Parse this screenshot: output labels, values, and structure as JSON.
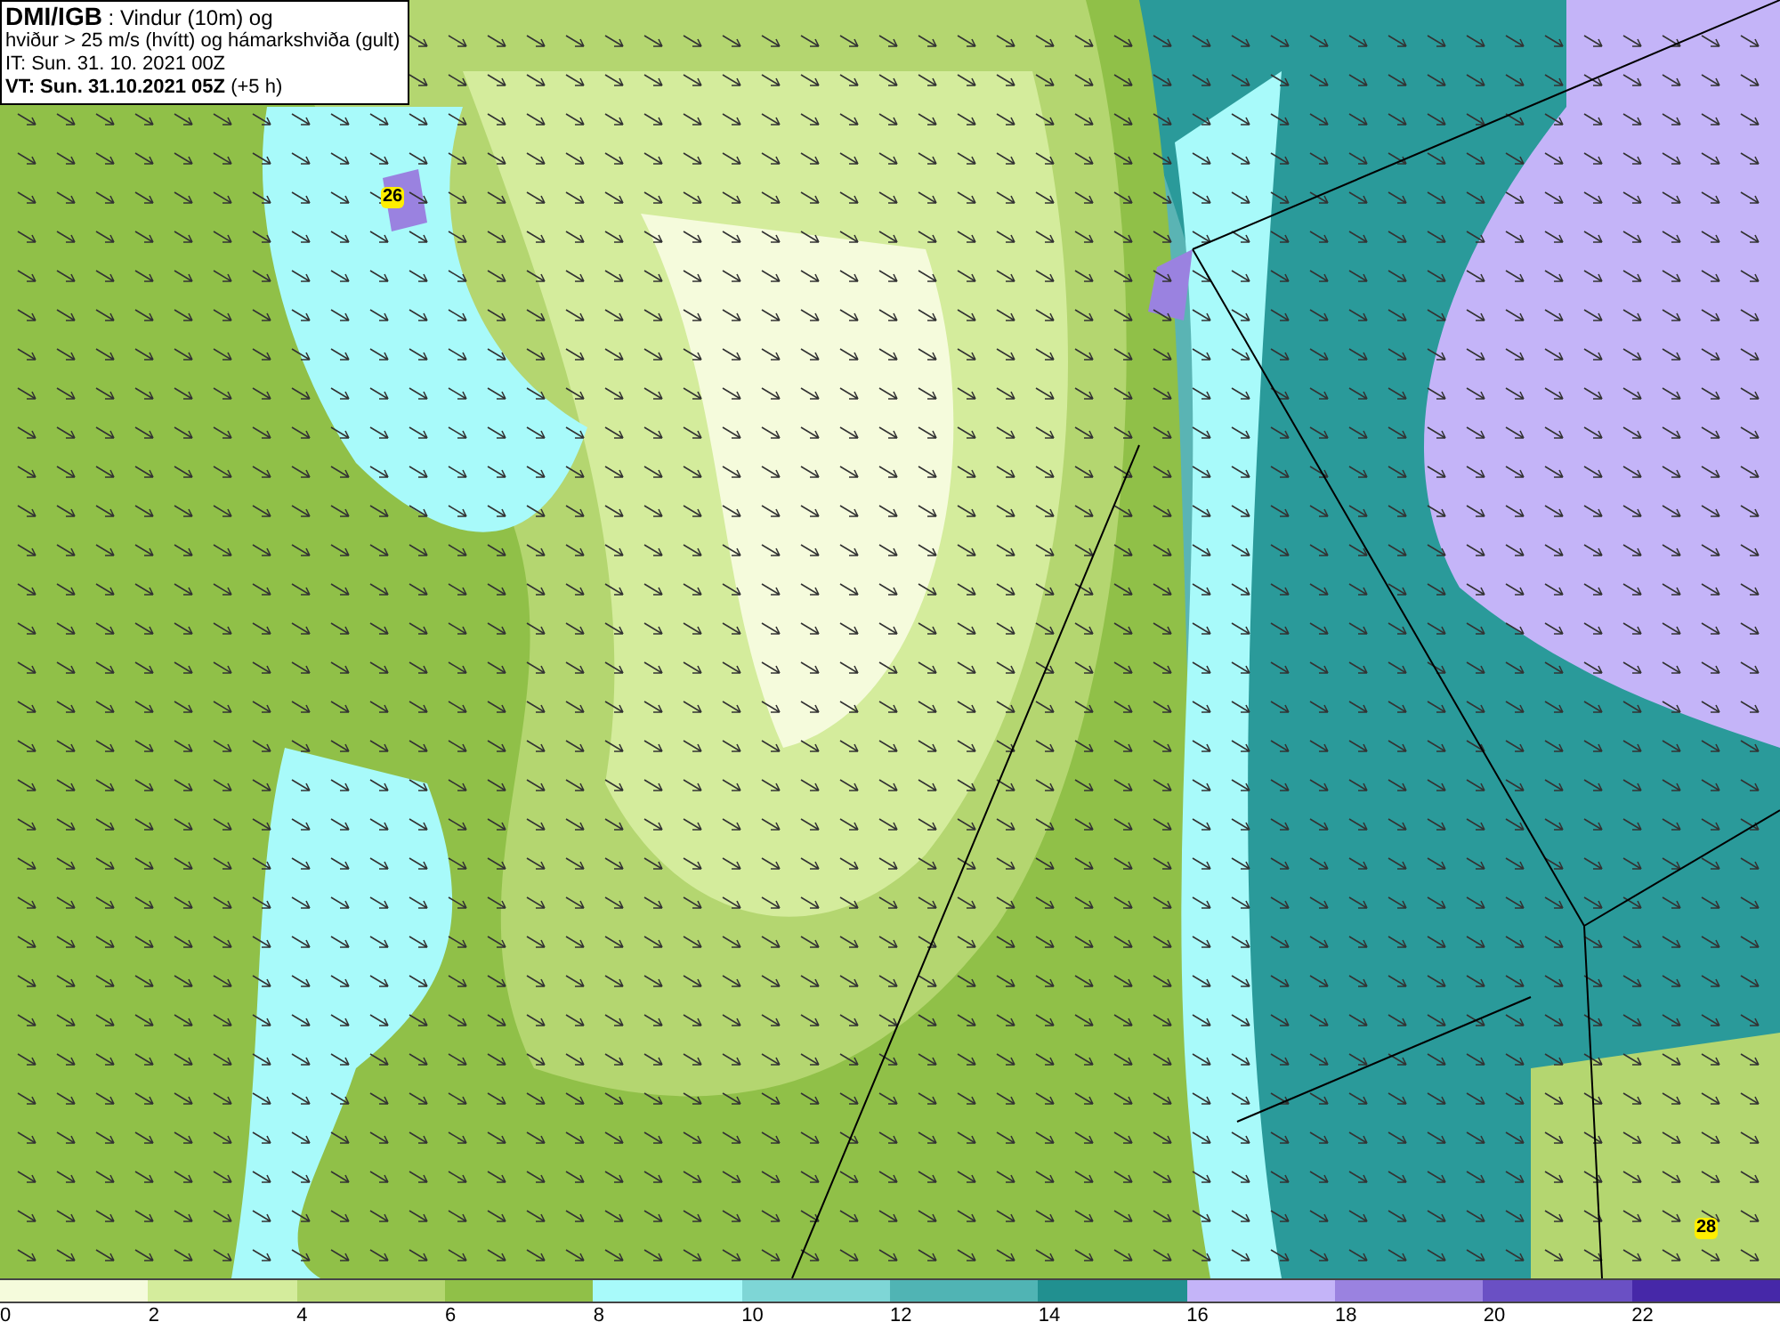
{
  "title_box": {
    "lines": [
      "**DMI/IGB** : Vindur (10m) og",
      "hviður > 25 m/s (hvítt) og hámarkshviða (gult)",
      "IT: Sun. 31. 10. 2021 00Z",
      "**VT: Sun. 31.10.2021 05Z** (+5 h)"
    ]
  },
  "gust_markers": [
    {
      "label": "26"
    },
    {
      "label": "28"
    }
  ],
  "legend": {
    "bins": [
      {
        "color": "#f5fbdc"
      },
      {
        "color": "#d4ec9c"
      },
      {
        "color": "#b4d670"
      },
      {
        "color": "#90c048"
      },
      {
        "color": "#a8fafa"
      },
      {
        "color": "#7ed6d6"
      },
      {
        "color": "#50b4b4"
      },
      {
        "color": "#219090"
      },
      {
        "color": "#c4b4f8"
      },
      {
        "color": "#9a82e0"
      },
      {
        "color": "#6a50c4"
      },
      {
        "color": "#4628a8"
      }
    ],
    "ticks": [
      "0",
      "2",
      "4",
      "6",
      "8",
      "10",
      "12",
      "14",
      "16",
      "18",
      "20",
      "22"
    ]
  }
}
